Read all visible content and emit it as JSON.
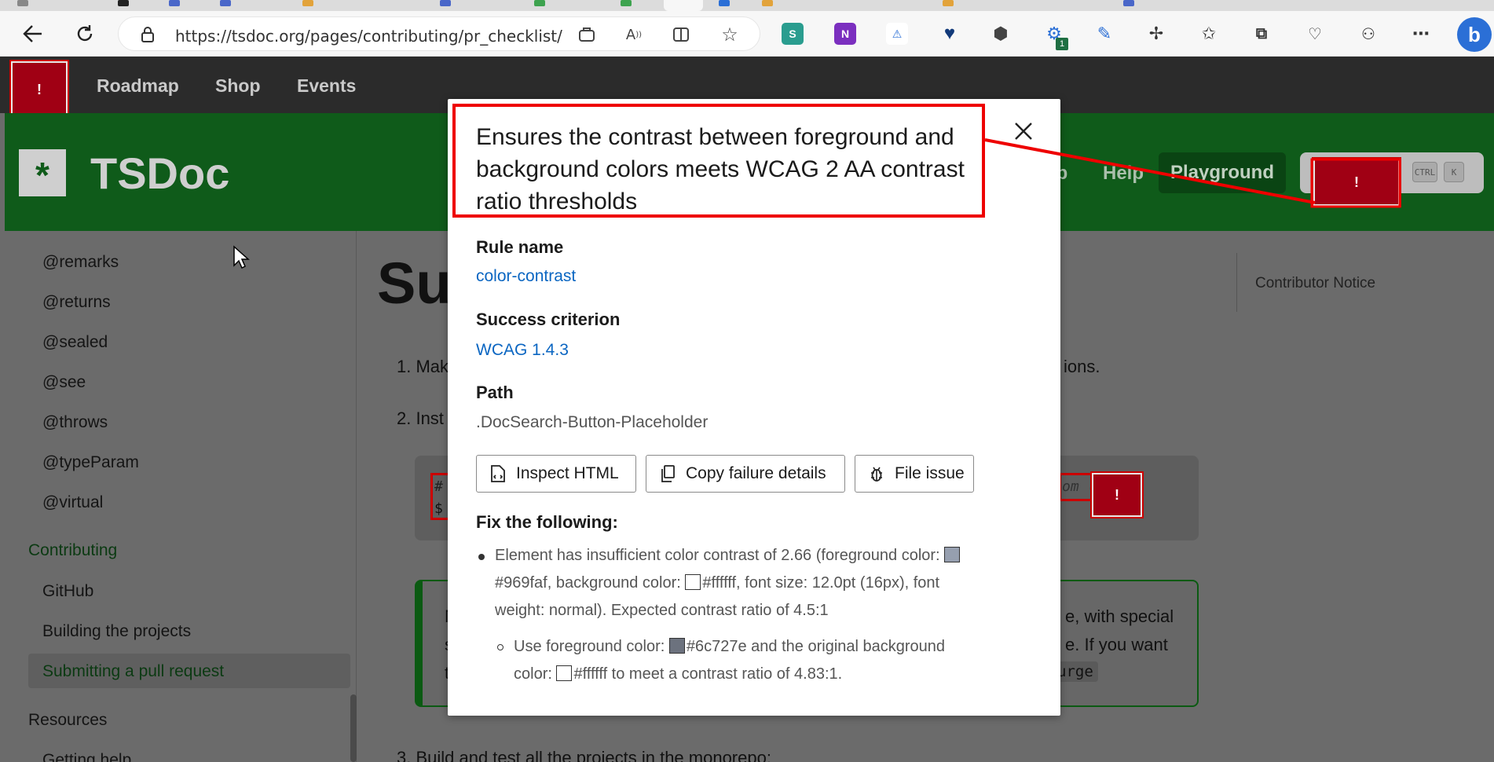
{
  "browser": {
    "url": "https://tsdoc.org/pages/contributing/pr_checklist/",
    "extension_badge": "1"
  },
  "site": {
    "nav": [
      "Roadmap",
      "Shop",
      "Events"
    ],
    "brand": "TSDoc",
    "header_links": [
      "ub",
      "Help"
    ],
    "playground": "Playground",
    "kbd_ctrl": "CTRL",
    "kbd_k": "K",
    "alert_mark": "!"
  },
  "sidebar": {
    "items_top": [
      "@remarks",
      "@returns",
      "@sealed",
      "@see",
      "@throws",
      "@typeParam",
      "@virtual"
    ],
    "contributing": "Contributing",
    "contributing_items": [
      "GitHub",
      "Building the projects",
      "Submitting a pull request"
    ],
    "resources": "Resources",
    "resources_items": [
      "Getting help"
    ]
  },
  "content": {
    "title_fragment": "Sul",
    "line1_start": "1. Mak",
    "line1_end": "ions.",
    "line2_start": "2. Inst",
    "code_hash": "#",
    "code_dollar": "$",
    "code_tail": "om (",
    "note_first": "N",
    "note_right_1": "e, with special",
    "note_right_2": "e. If you want",
    "note_code": "urge",
    "note_left_2": "s",
    "note_left_3": "t",
    "line3": "3. Build and test all the projects in the monorepo:",
    "toc": "Contributor Notice"
  },
  "dialog": {
    "title": "Ensures the contrast between foreground and background colors meets WCAG 2 AA contrast ratio thresholds",
    "rule_label": "Rule name",
    "rule_value": "color-contrast",
    "criterion_label": "Success criterion",
    "criterion_value": "WCAG 1.4.3",
    "path_label": "Path",
    "path_value": ".DocSearch-Button-Placeholder",
    "buttons": {
      "inspect": "Inspect HTML",
      "copy": "Copy failure details",
      "file": "File issue"
    },
    "fix_title": "Fix the following:",
    "fix_line1_a": "Element has insufficient color contrast of 2.66 (foreground color:",
    "fix_line1_b": "#969faf, background color:",
    "fix_line1_c": "#ffffff, font size: 12.0pt (16px), font",
    "fix_line1_d": "weight: normal). Expected contrast ratio of 4.5:1",
    "fix_sub_a": "Use foreground color:",
    "fix_sub_b": "#6c727e and the original background",
    "fix_sub_c": "color:",
    "fix_sub_d": "#ffffff to meet a contrast ratio of 4.83:1.",
    "colors": {
      "fg": "#969faf",
      "bg": "#ffffff",
      "suggested": "#6c727e"
    }
  }
}
